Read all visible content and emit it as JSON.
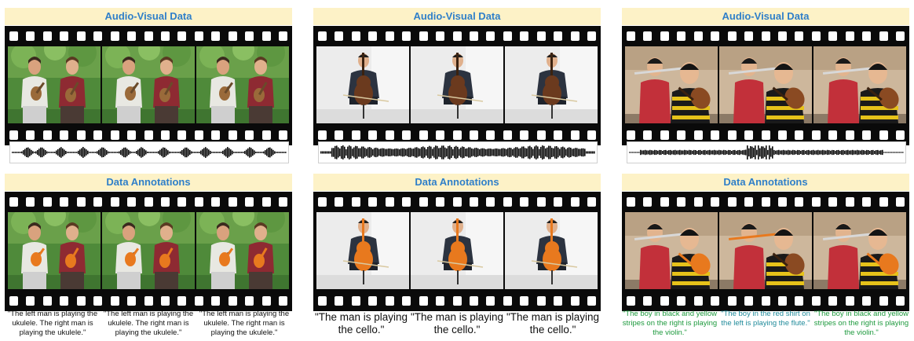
{
  "headers": {
    "audio_visual": "Audio-Visual Data",
    "annotations": "Data Annotations"
  },
  "columns": [
    {
      "scene": "ukulele-duo",
      "captions": [
        "\"The left man is playing the ukulele. The right man is playing the ukulele.\"",
        "\"The left man is playing the ukulele. The right man is playing the ukulele.\"",
        "\"The left man is playing the ukulele. The right man is playing the ukulele.\""
      ],
      "caption_style": "small"
    },
    {
      "scene": "cello-solo",
      "captions": [
        "\"The man is playing the cello.\"",
        "\"The man is playing the cello.\"",
        "\"The man is playing the cello.\""
      ],
      "caption_style": "big"
    },
    {
      "scene": "flute-violin-boys",
      "captions": [
        "\"The boy in black and yellow stripes on the right is playing the violin.\"",
        "\"The boy in the red shirt on the left is playing the flute.\"",
        "\"The boy in black and yellow stripes on the right is playing the violin.\""
      ],
      "caption_style": "mixed",
      "caption_colors": [
        "green",
        "teal",
        "green"
      ]
    }
  ],
  "colors": {
    "header_bg": "#fdf2c7",
    "header_text": "#2f7fc9",
    "mask_orange": "#e8791e",
    "film": "#0a0a0a",
    "caption_green": "#1e9a3e",
    "caption_teal": "#1f8a9a"
  }
}
